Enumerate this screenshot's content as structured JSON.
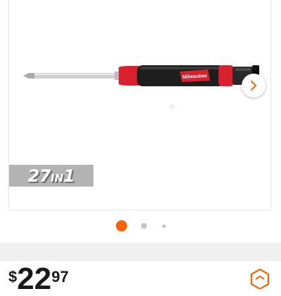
{
  "product": {
    "name": "Milwaukee 27-in-1 multi-bit screwdriver",
    "brand_mark": "Milwaukee",
    "badge": {
      "number": "27",
      "suffix_small": "IN",
      "number2": "1"
    },
    "colors": {
      "handle_red": "#d9202e",
      "grip_black": "#1c1c1c",
      "shaft": "#c8c8c8"
    }
  },
  "carousel": {
    "next_icon": "chevron-right-icon",
    "dots": [
      {
        "state": "active",
        "color": "#f96302"
      },
      {
        "state": "inactive",
        "color": "#c2c2c2"
      },
      {
        "state": "inactive",
        "color": "#c2c2c2"
      }
    ],
    "active_index": 0
  },
  "price": {
    "currency": "$",
    "dollars": "22",
    "cents": "97"
  },
  "corner_icon": "hexagon-badge-icon"
}
